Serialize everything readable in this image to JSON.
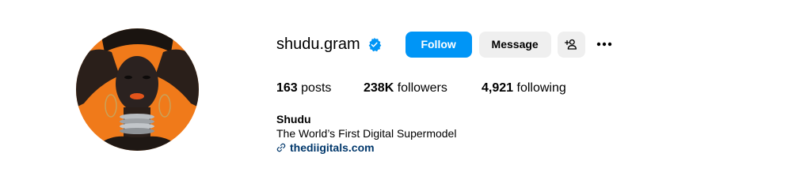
{
  "profile": {
    "username": "shudu.gram",
    "verified": true,
    "avatar_icon": "profile-photo"
  },
  "actions": {
    "follow_label": "Follow",
    "message_label": "Message",
    "suggest_icon": "person-add-icon",
    "more_icon": "more-options-icon"
  },
  "stats": {
    "posts_count": "163",
    "posts_label": "posts",
    "followers_count": "238K",
    "followers_label": "followers",
    "following_count": "4,921",
    "following_label": "following"
  },
  "bio": {
    "display_name": "Shudu",
    "description": "The World’s First Digital Supermodel",
    "link_text": "thediigitals.com",
    "link_icon": "link-icon"
  },
  "colors": {
    "follow_button": "#0095f6",
    "secondary_button": "#efefef",
    "verified_badge": "#0095f6",
    "link_text": "#00376b",
    "avatar_background": "#f07a1a"
  }
}
